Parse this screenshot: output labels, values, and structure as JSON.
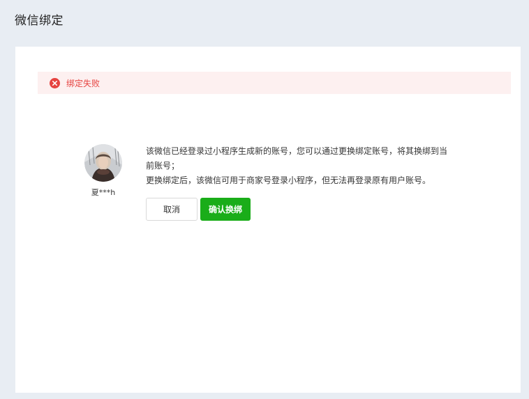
{
  "page": {
    "title": "微信绑定"
  },
  "alert": {
    "icon": "close-circle-icon",
    "text": "绑定失败",
    "color": "#e64340"
  },
  "user": {
    "nickname": "夏***h"
  },
  "message": {
    "line1": "该微信已经登录过小程序生成新的账号，您可以通过更换绑定账号，将其换绑到当前账号；",
    "line2": "更换绑定后，该微信可用于商家号登录小程序，但无法再登录原有用户账号。"
  },
  "buttons": {
    "cancel_label": "取消",
    "confirm_label": "确认换绑",
    "confirm_color": "#1aad19"
  }
}
